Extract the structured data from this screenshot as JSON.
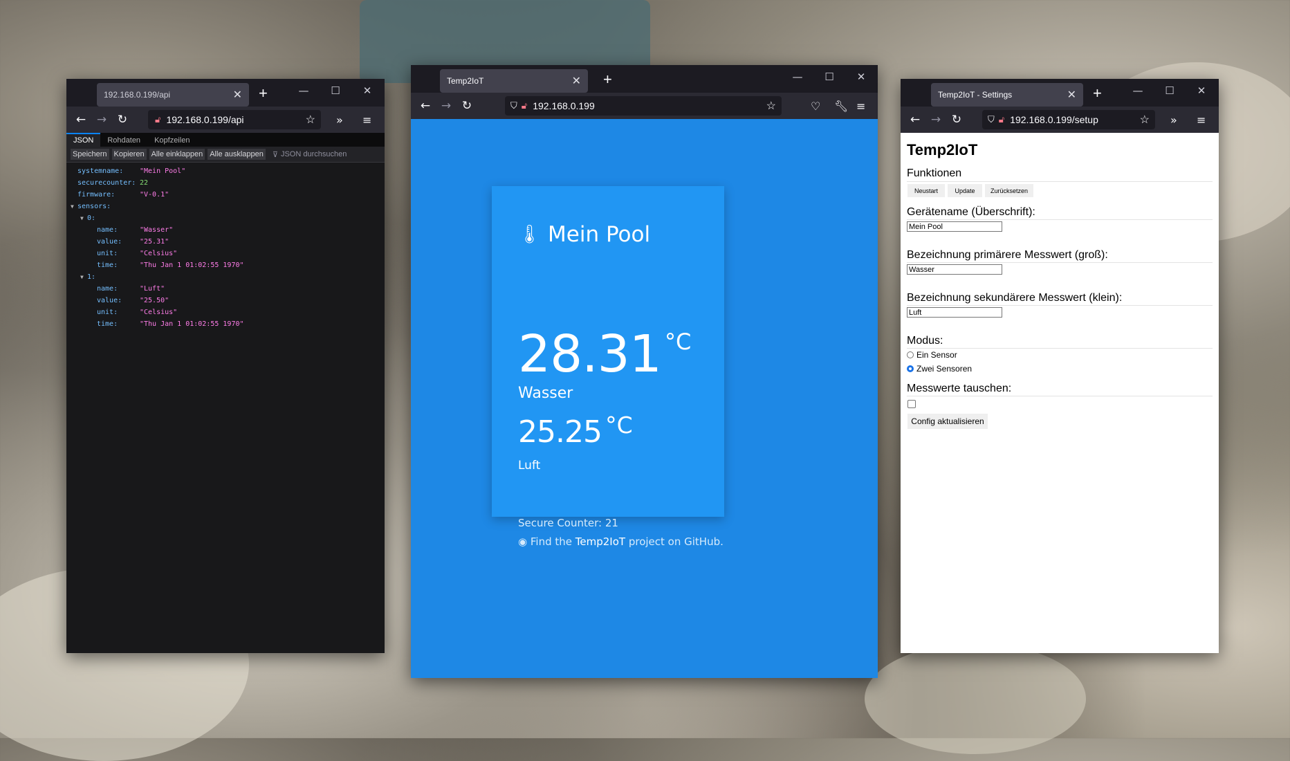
{
  "left_window": {
    "tab_title": "192.168.0.199/api",
    "url": "192.168.0.199/api",
    "viewer_tabs": [
      "JSON",
      "Rohdaten",
      "Kopfzeilen"
    ],
    "toolbar_buttons": [
      "Speichern",
      "Kopieren",
      "Alle einklappen",
      "Alle ausklappen"
    ],
    "filter_placeholder": "JSON durchsuchen",
    "json_rows": [
      {
        "key": "systemname:",
        "value": "\"Mein Pool\"",
        "type": "str",
        "indent": 0
      },
      {
        "key": "securecounter:",
        "value": "22",
        "type": "num",
        "indent": 0
      },
      {
        "key": "firmware:",
        "value": "\"V-0.1\"",
        "type": "str",
        "indent": 0
      },
      {
        "key": "sensors:",
        "value": "",
        "type": "obj",
        "indent": 0
      },
      {
        "key": "0:",
        "value": "",
        "type": "obj",
        "indent": 1
      },
      {
        "key": "name:",
        "value": "\"Wasser\"",
        "type": "str",
        "indent": 2
      },
      {
        "key": "value:",
        "value": "\"25.31\"",
        "type": "str",
        "indent": 2
      },
      {
        "key": "unit:",
        "value": "\"Celsius\"",
        "type": "str",
        "indent": 2
      },
      {
        "key": "time:",
        "value": "\"Thu Jan  1 01:02:55 1970\"",
        "type": "str",
        "indent": 2
      },
      {
        "key": "1:",
        "value": "",
        "type": "obj",
        "indent": 1
      },
      {
        "key": "name:",
        "value": "\"Luft\"",
        "type": "str",
        "indent": 2
      },
      {
        "key": "value:",
        "value": "\"25.50\"",
        "type": "str",
        "indent": 2
      },
      {
        "key": "unit:",
        "value": "\"Celsius\"",
        "type": "str",
        "indent": 2
      },
      {
        "key": "time:",
        "value": "\"Thu Jan  1 01:02:55 1970\"",
        "type": "str",
        "indent": 2
      }
    ]
  },
  "center_window": {
    "tab_title": "Temp2IoT",
    "url": "192.168.0.199",
    "system_name": "Mein Pool",
    "primary_value": "28.31",
    "primary_unit": "°C",
    "primary_label": "Wasser",
    "secondary_value": "25.25",
    "secondary_unit": "°C",
    "secondary_label": "Luft",
    "secure_counter": "Secure Counter: 21",
    "footer_prefix": "Find the ",
    "footer_link": "Temp2IoT",
    "footer_suffix": " project on GitHub."
  },
  "right_window": {
    "tab_title": "Temp2IoT - Settings",
    "url": "192.168.0.199/setup",
    "heading": "Temp2IoT",
    "functions_label": "Funktionen",
    "buttons": [
      "Neustart",
      "Update",
      "Zurücksetzen"
    ],
    "device_name_label": "Gerätename (Überschrift):",
    "device_name_value": "Mein Pool",
    "primary_label": "Bezeichnung primärere Messwert (groß):",
    "primary_value": "Wasser",
    "secondary_label": "Bezeichnung sekundärere Messwert (klein):",
    "secondary_value": "Luft",
    "mode_label": "Modus:",
    "mode_options": [
      "Ein Sensor",
      "Zwei Sensoren"
    ],
    "mode_selected": "Zwei Sensoren",
    "swap_label": "Messwerte tauschen:",
    "swap_checked": false,
    "submit_label": "Config aktualisieren"
  },
  "colors": {
    "page_blue": "#1e88e5",
    "card_blue": "#2196f3",
    "browser_dark": "#1c1b22",
    "json_key": "#75bfff",
    "json_string": "#ff7de9",
    "json_number": "#86de74"
  }
}
